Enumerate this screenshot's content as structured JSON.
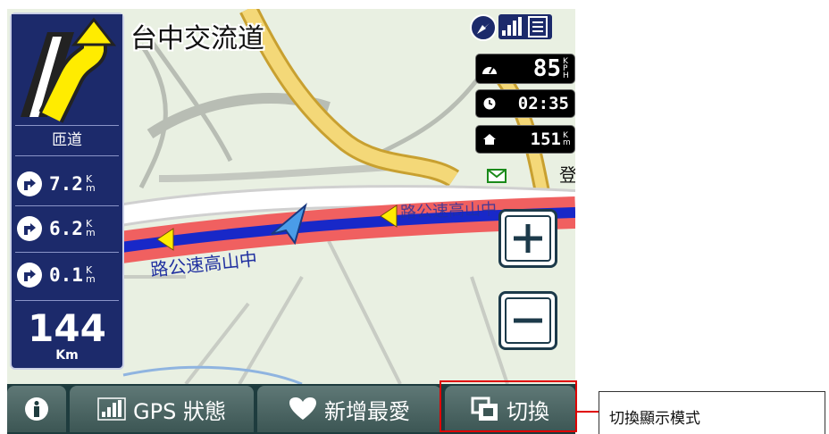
{
  "map": {
    "road_name": "台中交流道",
    "street_label_1": "路公速高山中",
    "street_label_2": "路公速高山中",
    "street_label_3": "登"
  },
  "guidance": {
    "turn_label": "匝道",
    "distances": [
      {
        "value": "7.2",
        "unit": "Km"
      },
      {
        "value": "6.2",
        "unit": "Km"
      },
      {
        "value": "0.1",
        "unit": "Km"
      }
    ],
    "total_distance": "144",
    "total_unit": "Km"
  },
  "status": {
    "speed": "85",
    "speed_unit": "KPH",
    "time": "02:35",
    "home_distance": "151",
    "home_unit": "Km"
  },
  "toolbar": {
    "info_label": "",
    "gps_label": "GPS 狀態",
    "favorite_label": "新增最愛",
    "switch_label": "切換"
  },
  "callout": {
    "text": "切換顯示模式"
  },
  "colors": {
    "panel_blue": "#1c2a6b",
    "route_red": "#f06060",
    "route_blue": "#1828c8",
    "highlight_red": "#e00000",
    "toolbar": "#1e3c3e"
  }
}
